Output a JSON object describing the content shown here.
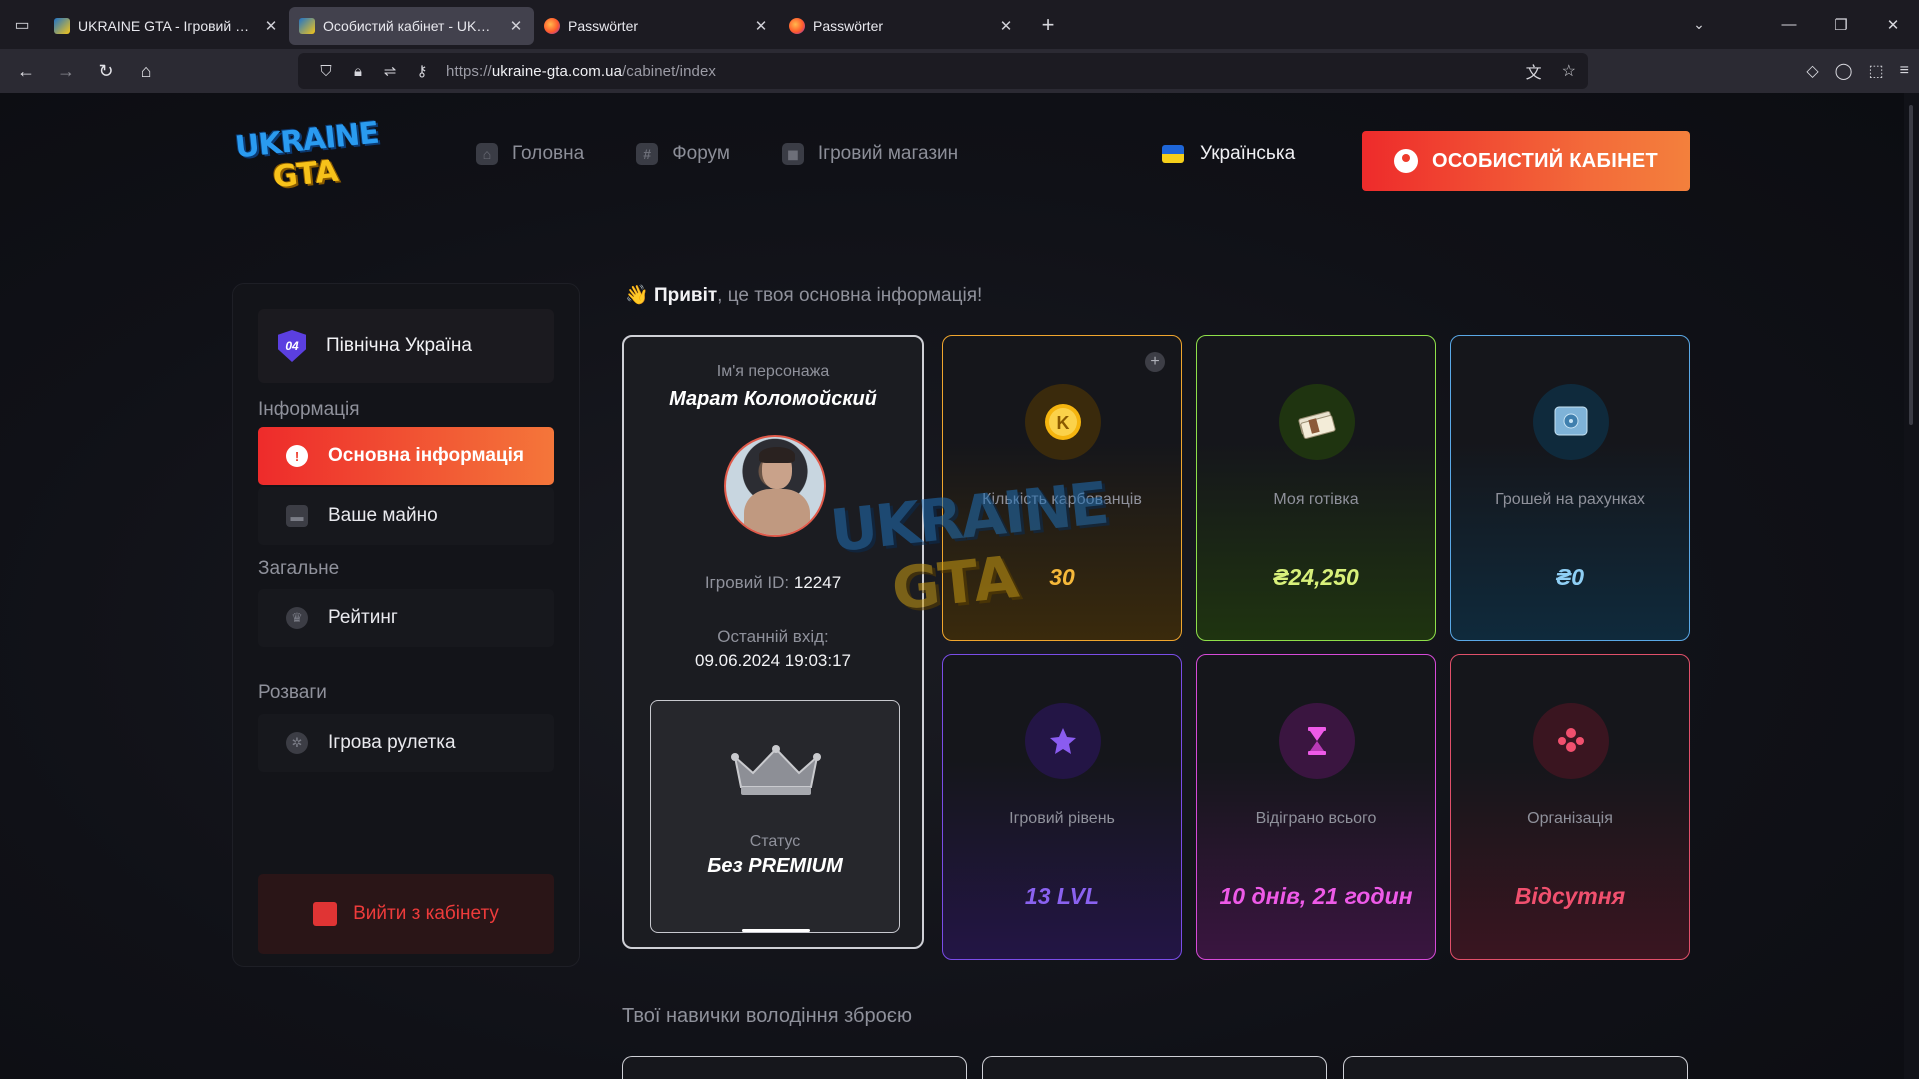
{
  "browser": {
    "tabs": [
      {
        "title": "UKRAINE GTA - Ігровий форум",
        "favicon": "gta",
        "active": false
      },
      {
        "title": "Особистий кабінет - UKRAINE GTA",
        "favicon": "gta",
        "active": true
      },
      {
        "title": "Passwörter",
        "favicon": "firefox",
        "active": false
      },
      {
        "title": "Passwörter",
        "favicon": "firefox",
        "active": false
      }
    ],
    "url_prefix": "https://",
    "url_host": "ukraine-gta.com.ua",
    "url_path": "/cabinet/index"
  },
  "header": {
    "logo_top": "UKRAINE",
    "logo_bottom": "GTA",
    "nav": [
      {
        "label": "Головна",
        "icon": "home-icon"
      },
      {
        "label": "Форум",
        "icon": "hash-icon"
      },
      {
        "label": "Ігровий магазин",
        "icon": "bag-icon"
      }
    ],
    "language": "Українська",
    "cabinet_button": "ОСОБИСТИЙ КАБІНЕТ"
  },
  "sidebar": {
    "server_badge": "04",
    "server_name": "Північна Україна",
    "section_info": "Інформація",
    "item_main": "Основна інформація",
    "item_property": "Ваше майно",
    "section_general": "Загальне",
    "item_rating": "Рейтинг",
    "section_fun": "Розваги",
    "item_roulette": "Ігрова рулетка",
    "logout": "Вийти з кабінету"
  },
  "greeting": {
    "emoji": "👋",
    "bold": "Привіт",
    "rest": ", це твоя основна інформація!"
  },
  "character": {
    "name_label": "Ім'я персонажа",
    "name": "Марат Коломойский",
    "id_label": "Ігровий ID:",
    "id": "12247",
    "last_login_label": "Останній вхід:",
    "last_login": "09.06.2024 19:03:17",
    "status_label": "Статус",
    "status": "Без PREMIUM"
  },
  "stats": [
    {
      "label": "Кількість карбованців",
      "value": "30",
      "icon": "karbovanets-coin-icon",
      "border": "#f0a62e",
      "color": "#f5b83a",
      "glow": "#3a2a0c"
    },
    {
      "label": "Моя готівка",
      "value": "₴24,250",
      "icon": "cash-stack-icon",
      "border": "#8fe04a",
      "color": "#d8f07a",
      "glow": "#1f3410"
    },
    {
      "label": "Грошей на рахунках",
      "value": "₴0",
      "icon": "safe-icon",
      "border": "#5aa8e6",
      "color": "#8fcff5",
      "glow": "#0f2a3c"
    },
    {
      "label": "Ігровий рівень",
      "value": "13 LVL",
      "icon": "star-level-icon",
      "border": "#7a4de8",
      "color": "#8a62f0",
      "glow": "#231545"
    },
    {
      "label": "Відіграно всього",
      "value": "10 днів, 21 годин",
      "icon": "hourglass-icon",
      "border": "#d64ad8",
      "color": "#ee5ae8",
      "glow": "#3a1540"
    },
    {
      "label": "Організація",
      "value": "Відсутня",
      "icon": "organization-icon",
      "border": "#e0506a",
      "color": "#f0506e",
      "glow": "#3a1520"
    }
  ],
  "skills": {
    "title": "Твої навички володіння зброєю"
  }
}
